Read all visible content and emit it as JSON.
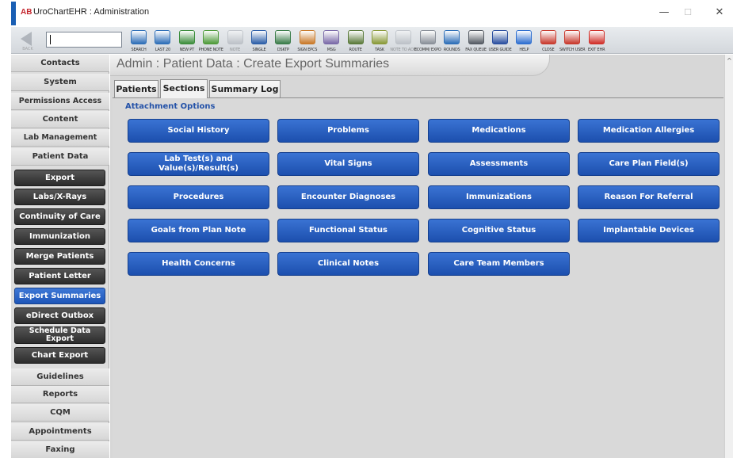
{
  "window": {
    "logo_text": "AB",
    "title": "UroChartEHR : Administration",
    "minimize_glyph": "—",
    "maximize_glyph": "☐",
    "close_glyph": "✕"
  },
  "toolbar": {
    "back_label": "BACK",
    "search_value": "",
    "buttons": [
      {
        "label": "SEARCH",
        "icon": "search-patient-icon",
        "color": "#2e6fb8"
      },
      {
        "label": "LAST 20",
        "icon": "last-20-icon",
        "color": "#2e6fb8"
      },
      {
        "label": "NEW PT",
        "icon": "new-patient-icon",
        "color": "#3c8d3c"
      },
      {
        "label": "PHONE NOTE",
        "icon": "phone-note-icon",
        "color": "#4e9a3a"
      },
      {
        "label": "NOTE",
        "icon": "note-icon",
        "color": "#9aa0a8"
      },
      {
        "label": "SINGLE",
        "icon": "single-icon",
        "color": "#2d5fa8"
      },
      {
        "label": "DSKTP",
        "icon": "desktop-icon",
        "color": "#3b7d4a"
      },
      {
        "label": "SIGN EPCS",
        "icon": "sign-epcs-icon",
        "color": "#c97a2a"
      },
      {
        "label": "MSG",
        "icon": "message-icon",
        "color": "#7a6aa8"
      },
      {
        "label": "ROUTE",
        "icon": "route-icon",
        "color": "#5a7a3a"
      },
      {
        "label": "TASK",
        "icon": "task-icon",
        "color": "#8a9a3a"
      },
      {
        "label": "NOTE TO ADMIN",
        "icon": "note-to-admin-icon",
        "color": "#9aa0a8"
      },
      {
        "label": "ECOMM/ EXPORT",
        "icon": "export-icon",
        "color": "#8a9099"
      },
      {
        "label": "ROUNDS",
        "icon": "rounds-icon",
        "color": "#2e6fb8"
      },
      {
        "label": "FAX QUEUE",
        "icon": "fax-queue-icon",
        "color": "#555b63"
      },
      {
        "label": "USER GUIDE",
        "icon": "user-guide-icon",
        "color": "#2b4fa0"
      },
      {
        "label": "HELP",
        "icon": "help-icon",
        "color": "#2e6fd0"
      },
      {
        "label": "CLOSE",
        "icon": "close-chart-icon",
        "color": "#c83a2e"
      },
      {
        "label": "SWITCH USER",
        "icon": "switch-user-icon",
        "color": "#c83a2e"
      },
      {
        "label": "EXIT EHR",
        "icon": "exit-icon",
        "color": "#d0302a"
      }
    ]
  },
  "sidebar": {
    "top_items": [
      "Contacts",
      "System",
      "Permissions Access",
      "Content",
      "Lab Management",
      "Patient Data"
    ],
    "sub_items": [
      "Export",
      "Labs/X-Rays",
      "Continuity of Care",
      "Immunization",
      "Merge Patients",
      "Patient Letter",
      "Export Summaries",
      "eDirect Outbox",
      "Schedule Data Export",
      "Chart Export"
    ],
    "active_sub": "Export Summaries",
    "bottom_items": [
      "Guidelines",
      "Reports",
      "CQM",
      "Appointments",
      "Faxing"
    ]
  },
  "main": {
    "page_title": "Admin : Patient Data : Create Export Summaries",
    "tabs": [
      "Patients",
      "Sections",
      "Summary Log"
    ],
    "active_tab": "Sections",
    "section_label": "Attachment Options",
    "options": [
      [
        "Social History",
        "Problems",
        "Medications",
        "Medication Allergies"
      ],
      [
        "Lab Test(s) and Value(s)/Result(s)",
        "Vital Signs",
        "Assessments",
        "Care Plan Field(s)"
      ],
      [
        "Procedures",
        "Encounter Diagnoses",
        "Immunizations",
        "Reason For Referral"
      ],
      [
        "Goals from Plan Note",
        "Functional Status",
        "Cognitive Status",
        "Implantable Devices"
      ],
      [
        "Health Concerns",
        "Clinical Notes",
        "Care Team Members"
      ]
    ]
  },
  "scrollbar": {
    "up_glyph": "^"
  }
}
